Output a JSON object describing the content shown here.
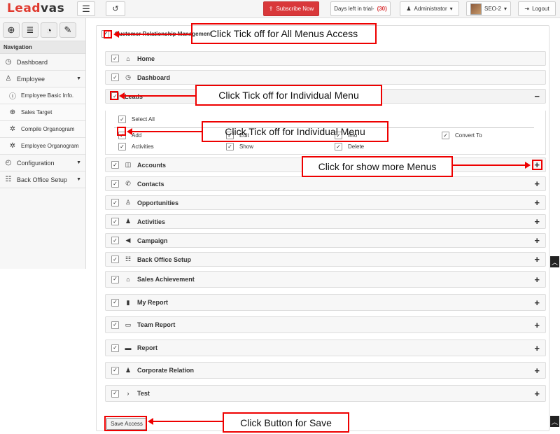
{
  "topbar": {
    "logo_part1": "Lead",
    "logo_part2": "vas",
    "subscribe_label": "Subscribe Now",
    "trial_label": "Days left in trial-",
    "trial_count": "(30)",
    "admin_label": "Administrator",
    "user_label": "SEO-2",
    "logout_label": "Logout"
  },
  "sidebar": {
    "heading": "Navigation",
    "items": [
      {
        "label": "Dashboard",
        "icon": "speedometer-icon"
      },
      {
        "label": "Employee",
        "icon": "person-icon"
      },
      {
        "label": "Employee Basic Info.",
        "icon": "info-icon"
      },
      {
        "label": "Sales Target",
        "icon": "target-icon"
      },
      {
        "label": "Compile Organogram",
        "icon": "organogram-icon"
      },
      {
        "label": "Employee Organogram",
        "icon": "organogram-icon"
      },
      {
        "label": "Configuration",
        "icon": "clock-icon"
      },
      {
        "label": "Back Office Setup",
        "icon": "sliders-icon"
      }
    ]
  },
  "main": {
    "title": "Customer Relationship Management",
    "menus": [
      "Home",
      "Dashboard",
      "Leads",
      "Accounts",
      "Contacts",
      "Opportunities",
      "Activities",
      "Campaign",
      "Back Office Setup",
      "Sales Achievement",
      "My Report",
      "Team Report",
      "Report",
      "Corporate Relation",
      "Test"
    ],
    "leads_collapse": "−",
    "plus": "+",
    "perms": {
      "select_all": "Select All",
      "add": "Add",
      "edit": "Edit",
      "info": "Info",
      "convert_to": "Convert To",
      "activities": "Activities",
      "show": "Show",
      "delete": "Delete"
    },
    "save_label": "Save Access"
  },
  "annotations": {
    "all_menus": "Click Tick off for All Menus Access",
    "individual_1": "Click Tick off for Individual Menu",
    "individual_2": "Click Tick off for Individual Menu",
    "show_more": "Click for show more Menus",
    "save": "Click Button for Save"
  },
  "colors": {
    "accent_red": "#d9383a",
    "annotation_red": "#ee0000"
  }
}
